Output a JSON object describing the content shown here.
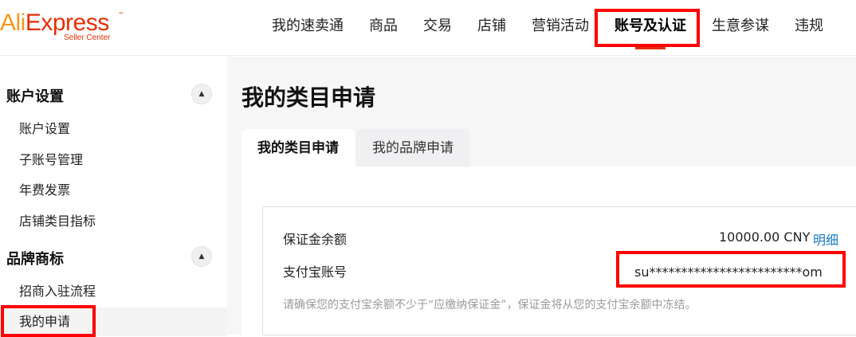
{
  "logo": {
    "ali": "Ali",
    "express": "Express",
    "tm": "™",
    "sub": "Seller Center"
  },
  "nav": [
    "我的速卖通",
    "商品",
    "交易",
    "店铺",
    "营销活动",
    "账号及认证",
    "生意参谋",
    "违规"
  ],
  "sidebar": {
    "groups": [
      {
        "title": "账户设置",
        "toggle": "▲",
        "items": [
          "账户设置",
          "子账号管理",
          "年费发票",
          "店铺类目指标"
        ]
      },
      {
        "title": "品牌商标",
        "toggle": "▲",
        "items": [
          "招商入驻流程",
          "我的申请"
        ]
      }
    ]
  },
  "main": {
    "title": "我的类目申请",
    "tabs": [
      "我的类目申请",
      "我的品牌申请"
    ],
    "deposit_label": "保证金余额",
    "deposit_value": "10000.00 CNY",
    "detail_link": "明细",
    "alipay_label": "支付宝账号",
    "alipay_value": "su************************om",
    "hint": "请确保您的支付宝余额不少于“应缴纳保证金”，保证金将从您的支付宝余额中冻结。"
  },
  "colors": {
    "accent": "#e62e04",
    "highlight": "#ff0000",
    "link": "#1a7ac8"
  }
}
